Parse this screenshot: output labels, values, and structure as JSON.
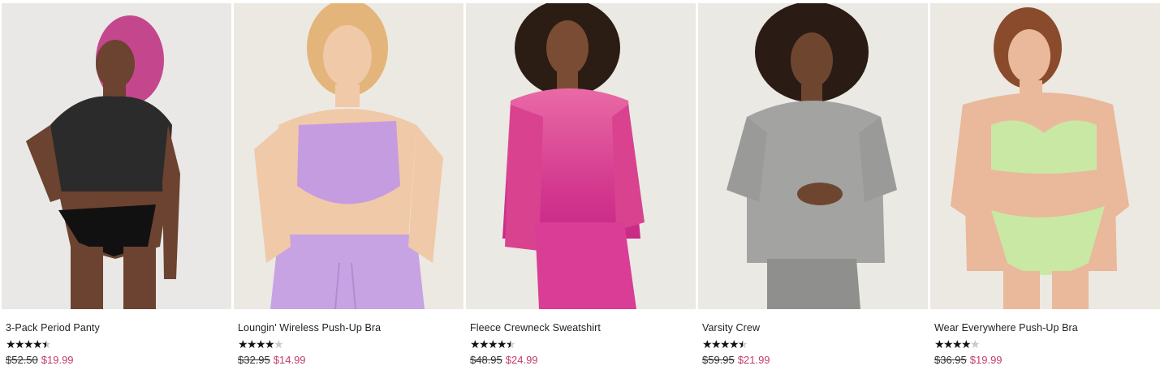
{
  "products": [
    {
      "name": "3-Pack Period Panty",
      "rating": 4.5,
      "original_price": "$52.50",
      "sale_price": "$19.99",
      "image": "model-tied-black-tee-black-panty"
    },
    {
      "name": "Loungin' Wireless Push-Up Bra",
      "rating": 4,
      "original_price": "$32.95",
      "sale_price": "$14.99",
      "image": "model-lilac-bra-lilac-joggers"
    },
    {
      "name": "Fleece Crewneck Sweatshirt",
      "rating": 4.5,
      "original_price": "$48.95",
      "sale_price": "$24.99",
      "image": "model-pink-ombre-sweatshirt"
    },
    {
      "name": "Varsity Crew",
      "rating": 4.5,
      "original_price": "$59.95",
      "sale_price": "$21.99",
      "image": "model-grey-marl-crew"
    },
    {
      "name": "Wear Everywhere Push-Up Bra",
      "rating": 4,
      "original_price": "$36.95",
      "sale_price": "$19.99",
      "image": "model-mint-lace-bra-set"
    }
  ],
  "colors": {
    "sale_price": "#c53b6c",
    "star_filled": "#111111",
    "star_empty": "#c9c9c9"
  }
}
